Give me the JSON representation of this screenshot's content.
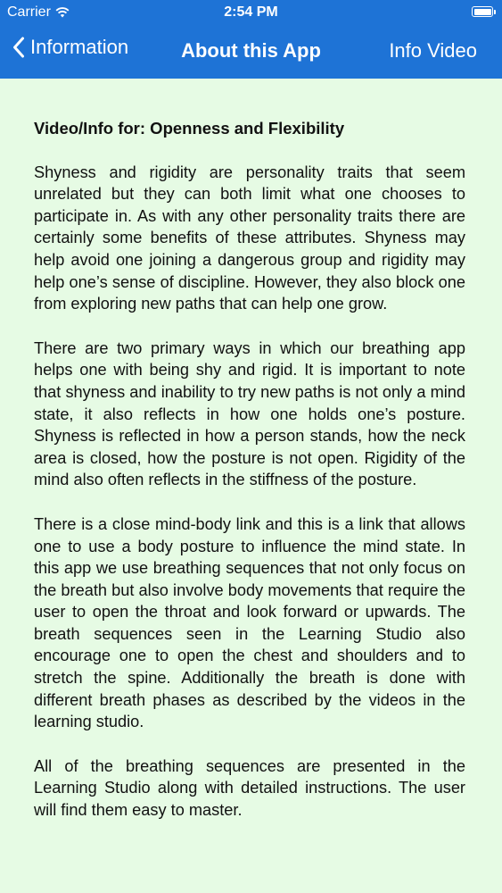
{
  "status_bar": {
    "carrier": "Carrier",
    "time": "2:54 PM"
  },
  "nav": {
    "back_label": "Information",
    "title": "About this App",
    "right_label": "Info Video"
  },
  "content": {
    "heading": "Video/Info for: Openness and Flexibility",
    "paragraphs": [
      "Shyness and rigidity are personality traits that seem unrelated but they can both limit what one chooses to participate in. As with any other personality traits there are certainly some benefits of these attributes. Shyness may help avoid one joining a dangerous group and rigidity may help one’s sense of discipline. However, they also block one from exploring new paths that can help one grow.",
      "There are two primary ways in which our breathing app helps one with being shy and rigid. It is important to note that shyness and inability to try new paths is not only a mind state, it also reflects in how one holds one’s posture. Shyness is reflected in how a person stands, how the neck area is closed, how the posture is not open. Rigidity of the mind also often reflects in the stiffness of the posture.",
      "There is a close mind-body link and this is a link that allows one to use a body posture to influence the mind state. In this app we use breathing sequences that not only focus on the breath but also involve body movements that require the user to open the throat and look forward or upwards. The breath sequences seen in the Learning Studio also encourage one to open the chest and shoulders and to stretch the spine. Additionally the breath is done with different breath phases as described by the videos in the learning studio.",
      "All of the breathing sequences are presented in the Learning Studio along with detailed instructions. The user will find them easy to master."
    ]
  },
  "icons": {
    "wifi": "wifi-icon",
    "battery": "battery-icon",
    "back": "chevron-left-icon"
  },
  "colors": {
    "nav_background": "#1e73d6",
    "page_background": "#e6fbe4",
    "text": "#111111"
  }
}
